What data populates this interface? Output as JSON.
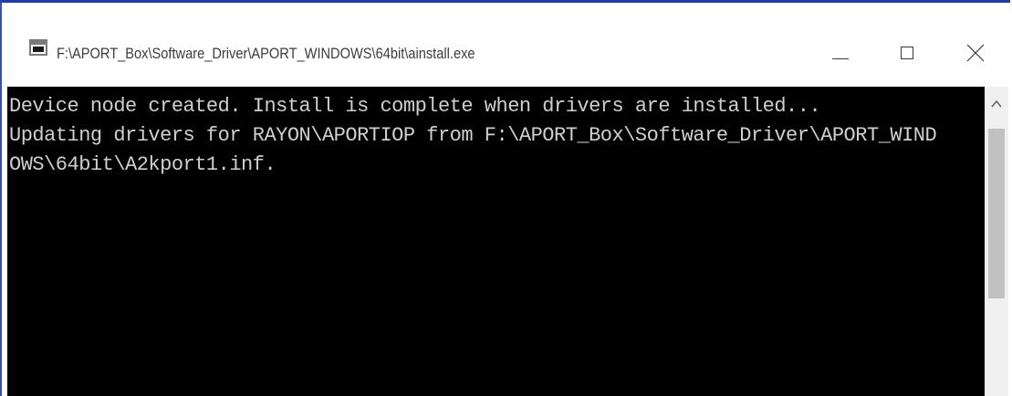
{
  "window": {
    "title": "F:\\APORT_Box\\Software_Driver\\APORT_WINDOWS\\64bit\\ainstall.exe",
    "icon": "console-app-icon",
    "controls": {
      "minimize": "minimize-icon",
      "maximize": "maximize-icon",
      "close": "close-icon"
    },
    "accent_color": "#1c3bb5"
  },
  "console": {
    "background_color": "#000000",
    "text_color": "#cfcfcf",
    "lines": [
      "Device node created. Install is complete when drivers are installed...",
      "Updating drivers for RAYON\\APORTIOP from F:\\APORT_Box\\Software_Driver\\APORT_WIND",
      "OWS\\64bit\\A2kport1.inf."
    ]
  },
  "scrollbar": {
    "up_arrow": "scroll-up-arrow-icon"
  }
}
